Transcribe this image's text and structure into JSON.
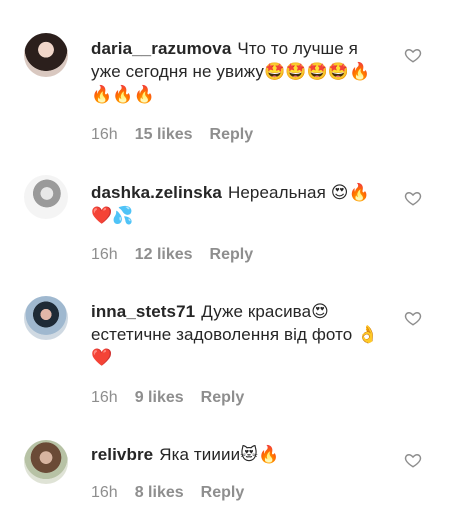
{
  "comments": [
    {
      "username": "daria__razumova",
      "text": "Что то лучше я уже сегодня не увижу🤩🤩🤩🤩🔥🔥🔥🔥",
      "time": "16h",
      "likes": "15 likes",
      "reply": "Reply"
    },
    {
      "username": "dashka.zelinska",
      "text": "Нереальная 😍🔥❤️💦",
      "time": "16h",
      "likes": "12 likes",
      "reply": "Reply"
    },
    {
      "username": "inna_stets71",
      "text": "Дуже красива😍 естетичне задоволення від фото 👌❤️",
      "time": "16h",
      "likes": "9 likes",
      "reply": "Reply"
    },
    {
      "username": "relivbre",
      "text": "Яка тииии😻🔥",
      "time": "16h",
      "likes": "8 likes",
      "reply": "Reply"
    }
  ]
}
